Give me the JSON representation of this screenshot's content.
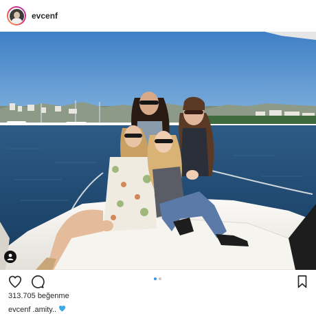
{
  "post": {
    "username": "evcenf",
    "likes_text": "313.705 beğenme",
    "caption_user": "evcenf",
    "caption_text": ".amity..",
    "caption_emoji": "blue-heart-icon",
    "carousel": {
      "count": 2,
      "active": 1
    }
  },
  "colors": {
    "sky": "#4a86c8",
    "sea": "#1f4a73",
    "boat_deck": "#f3f1ec",
    "carousel_active": "#3897f0"
  }
}
